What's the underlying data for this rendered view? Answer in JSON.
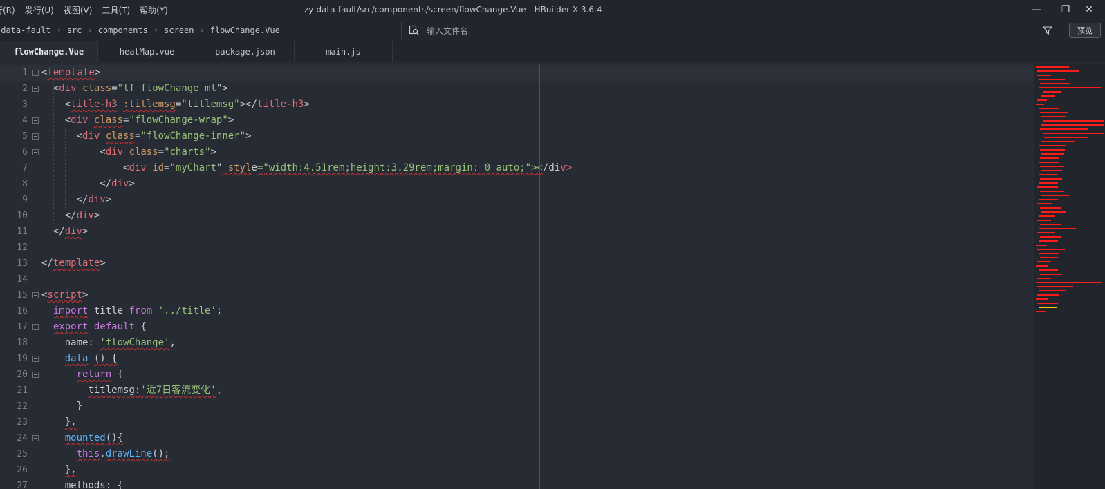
{
  "menu": [
    "行(R)",
    "发行(U)",
    "视图(V)",
    "工具(T)",
    "帮助(Y)"
  ],
  "window_title": "zy-data-fault/src/components/screen/flowChange.Vue - HBuilder X 3.6.4",
  "window_controls": {
    "minimize": "—",
    "maximize": "❐",
    "close": "✕"
  },
  "breadcrumb": [
    "-data-fault",
    "src",
    "components",
    "screen",
    "flowChange.Vue"
  ],
  "search": {
    "placeholder": "输入文件名"
  },
  "preview_button": "预览",
  "tabs": [
    {
      "label": "flowChange.Vue",
      "active": true
    },
    {
      "label": "heatMap.vue",
      "active": false
    },
    {
      "label": "package.json",
      "active": false
    },
    {
      "label": "main.js",
      "active": false
    }
  ],
  "editor": {
    "line_numbers": [
      "1",
      "2",
      "3",
      "4",
      "5",
      "6",
      "7",
      "8",
      "9",
      "10",
      "11",
      "12",
      "13",
      "14",
      "15",
      "16",
      "17",
      "18",
      "19",
      "20",
      "21",
      "22",
      "23",
      "24",
      "25",
      "26",
      "27"
    ],
    "code": [
      "<template>",
      "  <div class=\"lf flowChange ml\">",
      "    <title-h3 :titlemsg=\"titlemsg\"></title-h3>",
      "    <div class=\"flowChange-wrap\">",
      "      <div class=\"flowChange-inner\">",
      "          <div class=\"charts\">",
      "              <div id=\"myChart\" style=\"width:4.51rem;height:3.29rem;margin: 0 auto;\"></div>",
      "          </div>",
      "      </div>",
      "    </div>",
      "  </div>",
      "",
      "</template>",
      "",
      "<script>",
      "  import title from '../title';",
      "  export default {",
      "    name: 'flowChange',",
      "    data () {",
      "      return {",
      "        titlemsg:'近7日客流变化',",
      "      }",
      "    },",
      "    mounted(){",
      "      this.drawLine();",
      "    },",
      "    methods: {"
    ]
  }
}
